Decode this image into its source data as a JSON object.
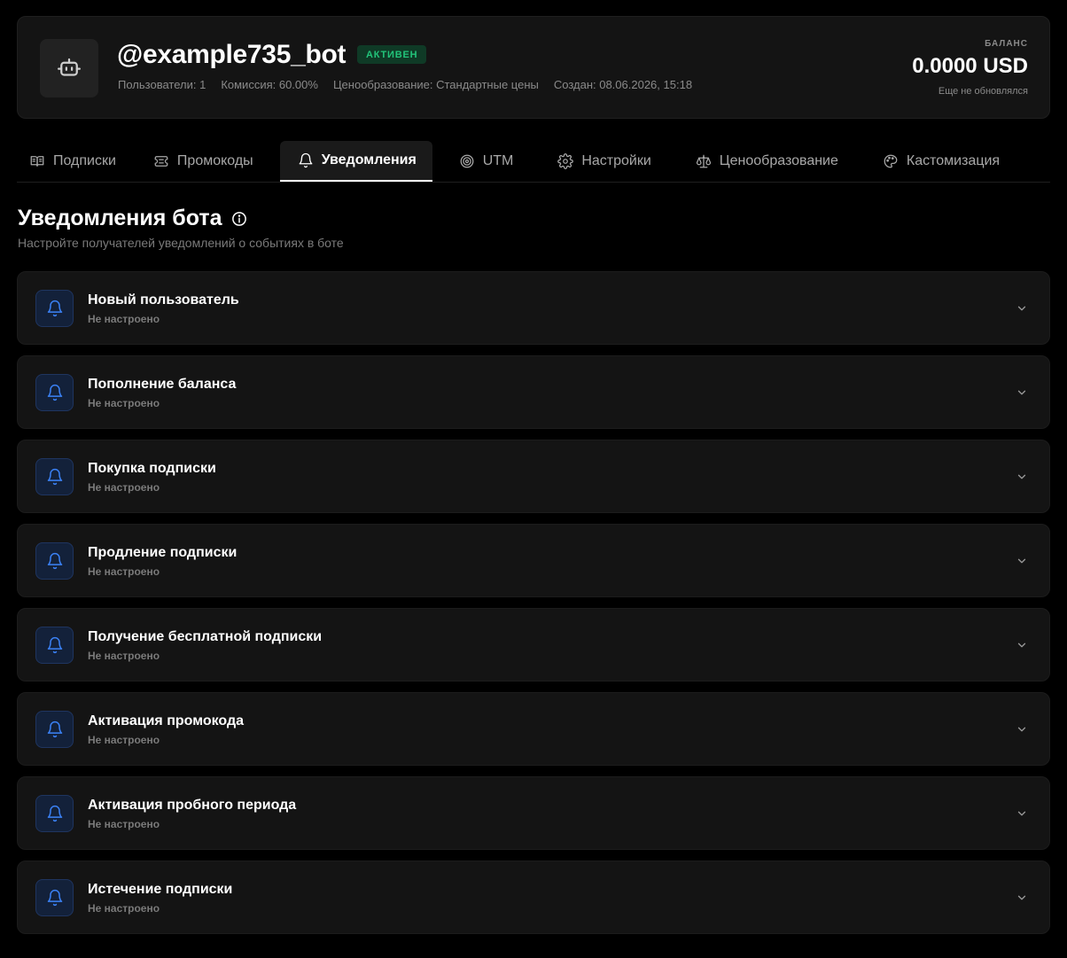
{
  "bot": {
    "title": "@example735_bot",
    "status": "АКТИВЕН",
    "meta": {
      "users": "Пользователи: 1",
      "commission": "Комиссия: 60.00%",
      "pricing": "Ценообразование: Стандартные цены",
      "created": "Создан: 08.06.2026, 15:18"
    },
    "balance": {
      "label": "БАЛАНС",
      "value": "0.0000 USD",
      "note": "Еще не обновлялся"
    }
  },
  "tabs": [
    {
      "label": "Подписки",
      "icon": "book-icon"
    },
    {
      "label": "Промокоды",
      "icon": "ticket-icon"
    },
    {
      "label": "Уведомления",
      "icon": "bell-icon",
      "active": true
    },
    {
      "label": "UTM",
      "icon": "target-icon"
    },
    {
      "label": "Настройки",
      "icon": "gear-icon"
    },
    {
      "label": "Ценообразование",
      "icon": "scale-icon"
    },
    {
      "label": "Кастомизация",
      "icon": "palette-icon"
    }
  ],
  "section": {
    "title": "Уведомления бота",
    "subtitle": "Настройте получателей уведомлений о событиях в боте"
  },
  "notifications": [
    {
      "title": "Новый пользователь",
      "status": "Не настроено"
    },
    {
      "title": "Пополнение баланса",
      "status": "Не настроено"
    },
    {
      "title": "Покупка подписки",
      "status": "Не настроено"
    },
    {
      "title": "Продление подписки",
      "status": "Не настроено"
    },
    {
      "title": "Получение бесплатной подписки",
      "status": "Не настроено"
    },
    {
      "title": "Активация промокода",
      "status": "Не настроено"
    },
    {
      "title": "Активация пробного периода",
      "status": "Не настроено"
    },
    {
      "title": "Истечение подписки",
      "status": "Не настроено"
    }
  ],
  "colors": {
    "background": "#000000",
    "card": "#141414",
    "accent_blue": "#3b82f6",
    "status_green": "#22c47a"
  }
}
